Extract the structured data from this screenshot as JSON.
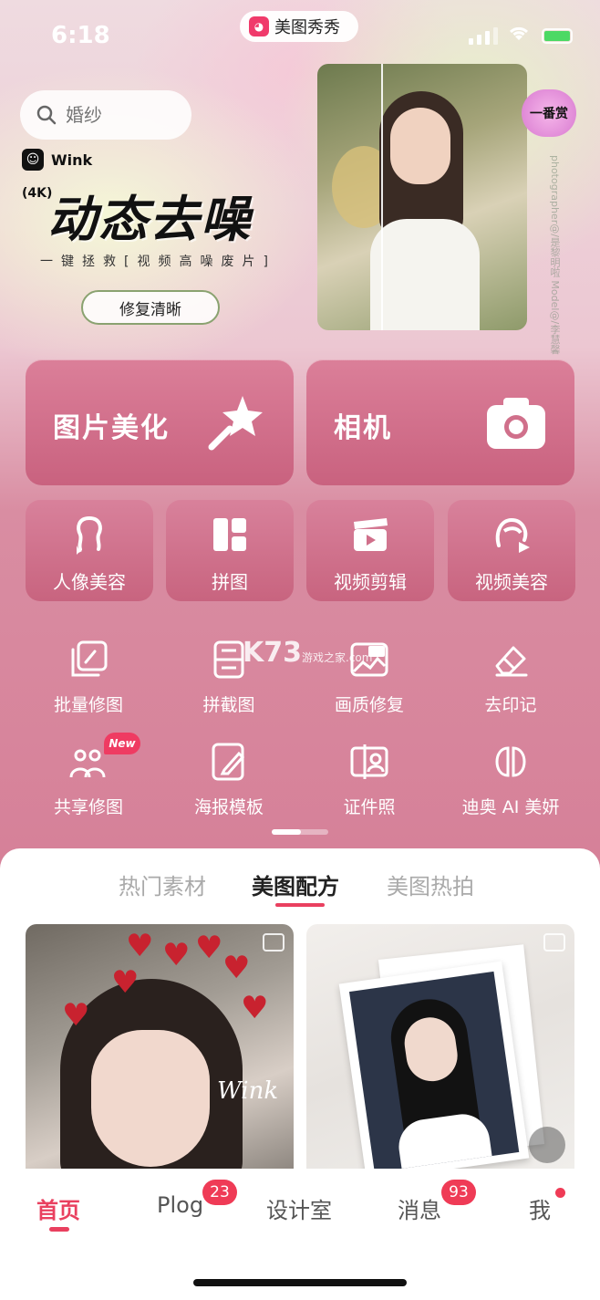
{
  "status_bar": {
    "time": "6:18",
    "app_name": "美图秀秀",
    "app_logo_glyph": "◕"
  },
  "search": {
    "placeholder": "婚纱"
  },
  "banner": {
    "brand": "Wink",
    "tag": "(4K)",
    "headline": "动态去噪",
    "subline": "一键拯救[视频高噪废片]",
    "button": "修复清晰",
    "corner_badge": "一番赏",
    "credit": "photographer@/是黎明啦  Model@/李慧馨"
  },
  "big_cards": [
    {
      "label": "图片美化",
      "icon": "magic-wand-star-icon"
    },
    {
      "label": "相机",
      "icon": "camera-icon"
    }
  ],
  "mid_cards": [
    {
      "label": "人像美容",
      "icon": "portrait-beauty-icon"
    },
    {
      "label": "拼图",
      "icon": "collage-grid-icon"
    },
    {
      "label": "视频剪辑",
      "icon": "clapperboard-icon"
    },
    {
      "label": "视频美容",
      "icon": "video-beauty-icon"
    }
  ],
  "tools": [
    {
      "label": "批量修图",
      "icon": "batch-edit-icon"
    },
    {
      "label": "拼截图",
      "icon": "screenshot-stitch-icon"
    },
    {
      "label": "画质修复",
      "icon": "hd-repair-icon"
    },
    {
      "label": "去印记",
      "icon": "eraser-icon"
    },
    {
      "label": "共享修图",
      "icon": "shared-edit-icon",
      "badge": "New"
    },
    {
      "label": "海报模板",
      "icon": "poster-template-icon"
    },
    {
      "label": "证件照",
      "icon": "id-photo-icon"
    },
    {
      "label": "迪奥 AI 美妍",
      "icon": "dior-ai-icon"
    }
  ],
  "watermark": {
    "main": "K73",
    "sub": "游戏之家",
    "domain": ".com"
  },
  "content_tabs": [
    "热门素材",
    "美图配方",
    "美图热拍"
  ],
  "content_tabs_active": 1,
  "feed": {
    "thumb1_overlay": "Wink"
  },
  "bottom_nav": [
    {
      "label": "首页",
      "active": true
    },
    {
      "label": "Plog",
      "badge": "23"
    },
    {
      "label": "设计室"
    },
    {
      "label": "消息",
      "badge": "93"
    },
    {
      "label": "我",
      "dot": true
    }
  ],
  "colors": {
    "accent": "#e9405f",
    "card": "#d0708b"
  }
}
